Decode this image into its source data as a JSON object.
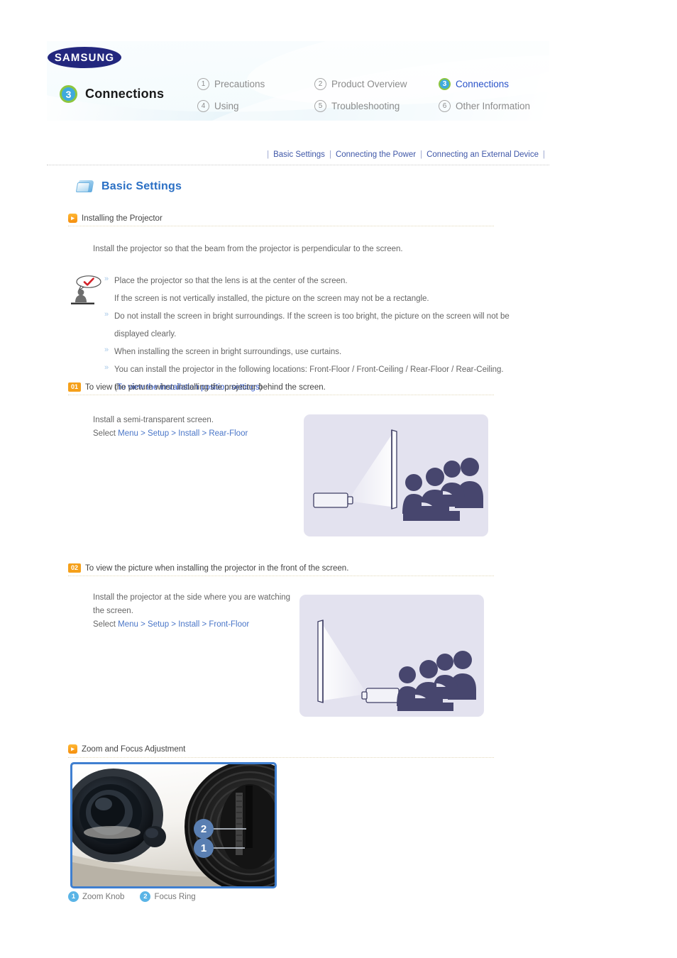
{
  "header": {
    "brand": "SAMSUNG",
    "current_chapter_number": "3",
    "current_chapter_title": "Connections",
    "nav": [
      {
        "num": "1",
        "label": "Precautions",
        "active": false
      },
      {
        "num": "2",
        "label": "Product Overview",
        "active": false
      },
      {
        "num": "3",
        "label": "Connections",
        "active": true
      },
      {
        "num": "4",
        "label": "Using",
        "active": false
      },
      {
        "num": "5",
        "label": "Troubleshooting",
        "active": false
      },
      {
        "num": "6",
        "label": "Other Information",
        "active": false
      }
    ]
  },
  "breadcrumb": {
    "sep": "|",
    "items": [
      "Basic Settings",
      "Connecting the Power",
      "Connecting an External Device"
    ]
  },
  "section": {
    "icon": "folder-icon",
    "title": "Basic Settings"
  },
  "installing": {
    "heading": "Installing the Projector",
    "intro": "Install the projector so that the beam from the projector is perpendicular to the screen.",
    "notes": [
      {
        "bullet": true,
        "text": "Place the projector so that the lens is at the center of the screen."
      },
      {
        "bullet": false,
        "text": "If the screen is not vertically installed, the picture on the screen may not be a rectangle."
      },
      {
        "bullet": true,
        "text": "Do not install the screen in bright surroundings. If the screen is too bright, the picture on the screen will not be"
      },
      {
        "bullet": false,
        "text": "displayed clearly."
      },
      {
        "bullet": true,
        "text": "When installing the screen in bright surroundings, use curtains."
      },
      {
        "bullet": true,
        "text": "You can install the projector in the following locations: Front-Floor / Front-Ceiling / Rear-Floor / Rear-Ceiling."
      }
    ],
    "link_open_paren": "(",
    "link_text": "To view the installation position settings",
    "link_close_paren": ")"
  },
  "step01": {
    "num": "01",
    "heading": "To view the picture when installing the projector behind the screen.",
    "desc_line1": "Install a semi-transparent screen.",
    "desc_select_label": "Select",
    "desc_menu_path": "Menu > Setup > Install > Rear-Floor",
    "illustration": "projector-behind-screen-diagram"
  },
  "step02": {
    "num": "02",
    "heading": "To view the picture when installing the projector in the front of the screen.",
    "desc_line1": "Install the projector at the side where you are watching",
    "desc_line2": "the screen.",
    "desc_select_label": "Select",
    "desc_menu_path": "Menu > Setup > Install > Front-Floor",
    "illustration": "projector-front-of-screen-diagram"
  },
  "zoomfocus": {
    "heading": "Zoom and Focus Adjustment",
    "photo": "projector-lens-zoom-focus-photo",
    "callouts": [
      {
        "num": "1",
        "label": "Zoom Knob"
      },
      {
        "num": "2",
        "label": "Focus Ring"
      }
    ],
    "photo_markers": [
      {
        "num": "2"
      },
      {
        "num": "1"
      }
    ]
  },
  "colors": {
    "brand_blue": "#23277e",
    "active_link": "#2a53c9",
    "section_title": "#2a6fc4",
    "badge_ring_green": "#8dc63f",
    "badge_fill_blue": "#3fa9dd",
    "orange_marker": "#f5a01a",
    "illustration_bg": "#e3e2ef",
    "silhouette": "#4a4a73",
    "photo_border": "#3f7fd0",
    "callout_circle": "#5ab4e6"
  }
}
